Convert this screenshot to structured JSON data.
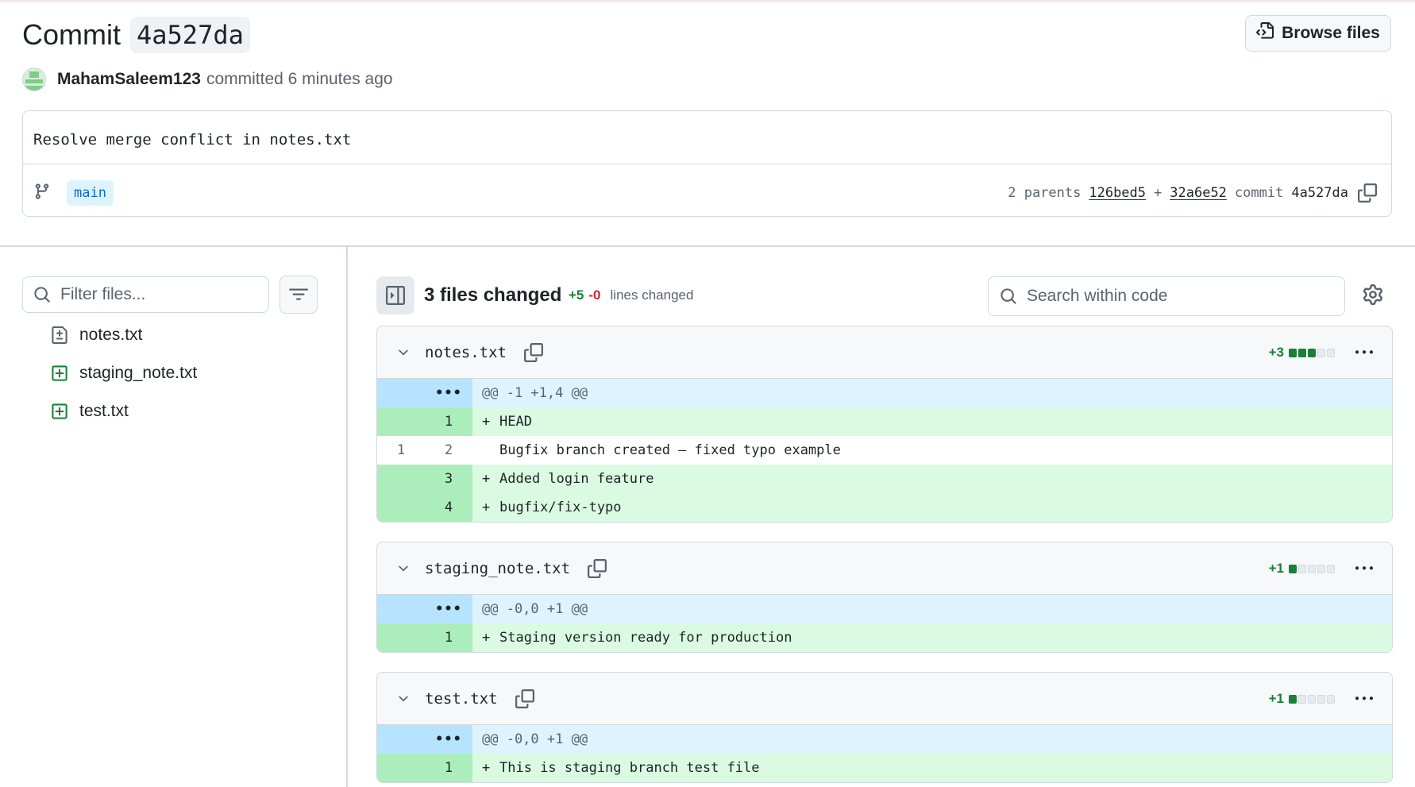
{
  "header": {
    "commit_label": "Commit",
    "commit_sha": "4a527da",
    "browse_files": "Browse files",
    "author": "MahamSaleem123",
    "committed_text": "committed 6 minutes ago"
  },
  "commit_message": "Resolve merge conflict in notes.txt",
  "branch": "main",
  "parents": {
    "label": "2 parents",
    "parent1": "126bed5",
    "plus": "+",
    "parent2": "32a6e52",
    "commit_label": "commit",
    "commit_sha": "4a527da"
  },
  "sidebar": {
    "filter_placeholder": "Filter files...",
    "files": [
      {
        "name": "notes.txt",
        "icon": "file-diff-icon"
      },
      {
        "name": "staging_note.txt",
        "icon": "file-added-icon"
      },
      {
        "name": "test.txt",
        "icon": "file-added-icon"
      }
    ]
  },
  "toolbar": {
    "files_changed": "3 files changed",
    "additions": "+5",
    "deletions": "-0",
    "lines_changed": "lines changed",
    "search_placeholder": "Search within code"
  },
  "files": [
    {
      "name": "notes.txt",
      "stat": "+3",
      "stat_blocks_filled": 3,
      "hunk": "@@ -1 +1,4 @@",
      "lines": [
        {
          "type": "added",
          "old": "",
          "new": "1",
          "mark": "+",
          "text": "HEAD"
        },
        {
          "type": "context",
          "old": "1",
          "new": "2",
          "mark": " ",
          "text": "Bugfix branch created – fixed typo example"
        },
        {
          "type": "added",
          "old": "",
          "new": "3",
          "mark": "+",
          "text": "Added login feature"
        },
        {
          "type": "added",
          "old": "",
          "new": "4",
          "mark": "+",
          "text": "bugfix/fix-typo"
        }
      ]
    },
    {
      "name": "staging_note.txt",
      "stat": "+1",
      "stat_blocks_filled": 1,
      "hunk": "@@ -0,0 +1 @@",
      "lines": [
        {
          "type": "added",
          "old": "",
          "new": "1",
          "mark": "+",
          "text": "Staging version ready for production"
        }
      ]
    },
    {
      "name": "test.txt",
      "stat": "+1",
      "stat_blocks_filled": 1,
      "hunk": "@@ -0,0 +1 @@",
      "lines": [
        {
          "type": "added",
          "old": "",
          "new": "1",
          "mark": "+",
          "text": "This is staging branch test file"
        }
      ]
    }
  ],
  "colors": {
    "added_bg": "#dafbe1",
    "added_gutter": "#aceebb",
    "hunk_bg": "#ddf4ff",
    "hunk_gutter": "#b6e3ff",
    "add_text": "#1a7f37",
    "del_text": "#d1242f",
    "branch_pill_bg": "#ddf4ff",
    "branch_pill_text": "#0969da"
  }
}
